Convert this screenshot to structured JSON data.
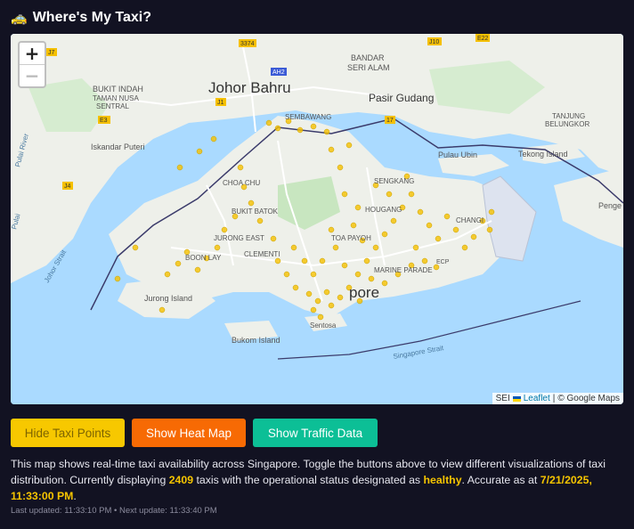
{
  "header": {
    "icon": "taxi-icon",
    "title": "Where's My Taxi?"
  },
  "map": {
    "zoom_in": "+",
    "zoom_out": "−",
    "labels": {
      "johor_bahru": "Johor Bahru",
      "bandar_seri_alam": "BANDAR",
      "seri_alam": "SERI ALAM",
      "pasir_gudang": "Pasir Gudang",
      "bukit_indah": "BUKIT INDAH",
      "taman_nusa_sentral_1": "TAMAN NUSA",
      "taman_nusa_sentral_2": "SENTRAL",
      "iskandar_puteri": "Iskandar Puteri",
      "pulau_ubin": "Pulau Ubin",
      "tekong_island": "Tekong Island",
      "tanjung_belungkor_1": "TANJUNG",
      "tanjung_belungkor_2": "BELUNGKOR",
      "pengerang": "Penge",
      "johor_strait": "Johor Strait",
      "jurong_island": "Jurong Island",
      "bukom_island": "Bukom Island",
      "sentosa": "Sentosa",
      "singapore_strait": "Singapore Strait",
      "singapore": "pore",
      "sembawang": "SEMBAWANG",
      "choa_chu_kang": "CHOA CHU",
      "bukit_batok": "BUKIT BATOK",
      "jurong_east": "JURONG EAST",
      "clementi": "CLEMENTI",
      "boon_lay": "BOON LAY",
      "hougang": "HOUGANG",
      "sengkang": "SENGKANG",
      "toa_payoh": "TOA PAYOH",
      "marine_parade": "MARINE PARADE",
      "changi": "CHANGI",
      "ecp": "ECP",
      "pulai_river": "Pulai River",
      "rulai": "Pulai",
      "road_3374": "3374",
      "road_e22": "E22",
      "road_e3": "E3",
      "road_j1": "J1",
      "road_j4": "J4",
      "road_j7": "J7",
      "road_j10": "J10",
      "road_17": "17",
      "road_ah2": "AH2"
    },
    "attribution": {
      "sep": "SEI",
      "leaflet": "Leaflet",
      "divider": "|",
      "google": "© Google Maps"
    },
    "point_color": "#f5c000"
  },
  "buttons": {
    "taxi_points": "Hide Taxi Points",
    "heat_map": "Show Heat Map",
    "traffic": "Show Traffic Data"
  },
  "description": {
    "part1": "This map shows real-time taxi availability across Singapore. Toggle the buttons above to view different visualizations of taxi distribution. Currently displaying ",
    "count": "2409",
    "part2": " taxis with the operational status designated as ",
    "status": "healthy",
    "part3": ". Accurate as at ",
    "timestamp": "7/21/2025, 11:33:00 PM",
    "part4": "."
  },
  "status_line": "Last updated: 11:33:10 PM • Next update: 11:33:40 PM",
  "colors": {
    "background": "#121222",
    "accent_yellow": "#f7c800",
    "accent_orange": "#f76a04",
    "accent_teal": "#0cbf96"
  }
}
